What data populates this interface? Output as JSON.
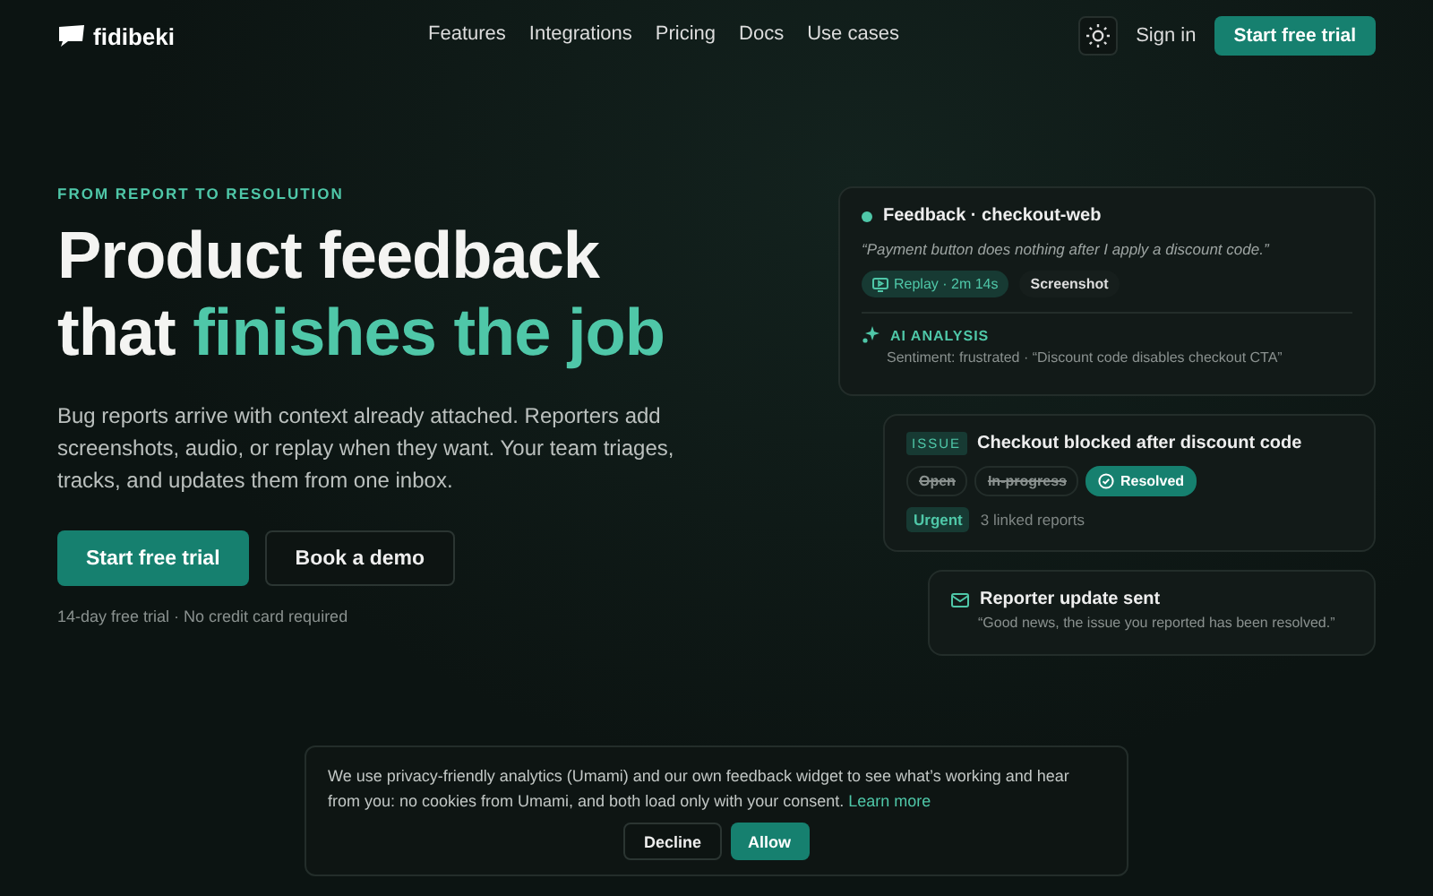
{
  "brand": {
    "name": "fidibeki"
  },
  "nav": {
    "links": [
      "Features",
      "Integrations",
      "Pricing",
      "Docs",
      "Use cases"
    ],
    "sign_in": "Sign in",
    "cta": "Start free trial"
  },
  "hero": {
    "eyebrow": "FROM REPORT TO RESOLUTION",
    "title_line1": "Product feedback",
    "title_line2_plain": "that",
    "title_line2_accent": "finishes the job",
    "body": "Bug reports arrive with context already attached. Reporters add screenshots, audio, or replay when they want. Your team triages, tracks, and updates them from one inbox.",
    "primary": "Start free trial",
    "secondary": "Book a demo",
    "note": "14-day free trial · No credit card required"
  },
  "feedback_card": {
    "title": "Feedback · checkout-web",
    "quote": "“Payment button does nothing after I apply a discount code.”",
    "attachments": [
      {
        "label": "Replay · 2m 14s",
        "kind": "replay"
      },
      {
        "label": "Screenshot",
        "kind": "plain"
      }
    ],
    "ai_label": "AI ANALYSIS",
    "ai_text": "Sentiment: frustrated · “Discount code disables checkout CTA”"
  },
  "issue_card": {
    "tag": "ISSUE",
    "title": "Checkout blocked after discount code",
    "statuses": [
      {
        "label": "Open",
        "selected": false
      },
      {
        "label": "In-progress",
        "selected": false
      },
      {
        "label": "Resolved",
        "selected": true
      }
    ],
    "priority": "Urgent",
    "linked": "3 linked reports"
  },
  "update_card": {
    "title": "Reporter update sent",
    "text": "“Good news, the issue you reported has been resolved.”"
  },
  "cookie_banner": {
    "text": "We use privacy-friendly analytics (Umami) and our own feedback widget to see what’s working and hear from you: no cookies from Umami, and both load only with your consent.",
    "link": "Learn more",
    "decline": "Decline",
    "allow": "Allow"
  }
}
